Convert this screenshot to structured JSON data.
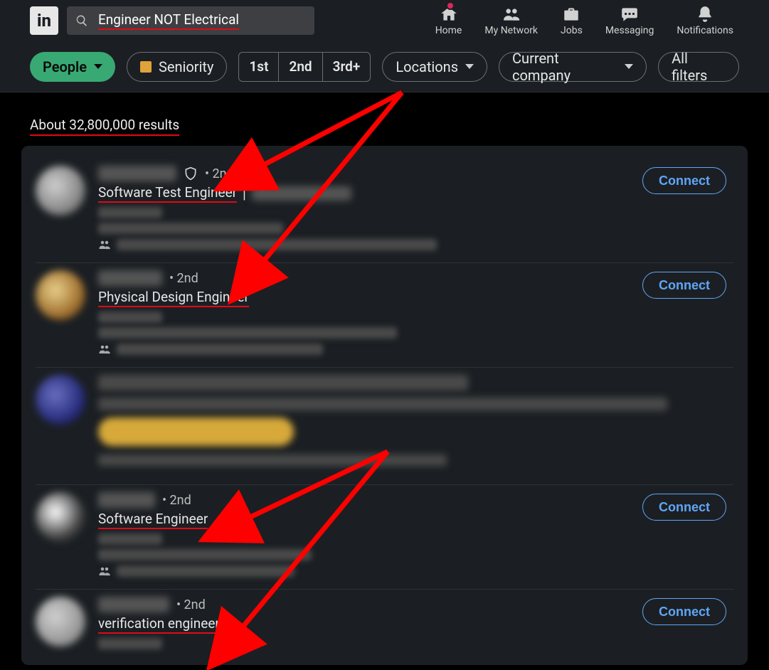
{
  "search_query": "Engineer NOT Electrical",
  "nav": {
    "home": "Home",
    "my_network": "My Network",
    "jobs": "Jobs",
    "messaging": "Messaging",
    "notifications": "Notifications"
  },
  "filters": {
    "people": "People",
    "seniority": "Seniority",
    "conn_1st": "1st",
    "conn_2nd": "2nd",
    "conn_3rd": "3rd+",
    "locations": "Locations",
    "current_company": "Current company",
    "all_filters": "All filters"
  },
  "results_count": "About 32,800,000 results",
  "connect_label": "Connect",
  "results": [
    {
      "degree": "• 2nd",
      "title": "Software Test Engineer",
      "title_sep": "|"
    },
    {
      "degree": "• 2nd",
      "title": "Physical Design Engineer"
    },
    {
      "promo": true
    },
    {
      "degree": "• 2nd",
      "title": "Software Engineer"
    },
    {
      "degree": "• 2nd",
      "title": "verification engineer"
    }
  ]
}
